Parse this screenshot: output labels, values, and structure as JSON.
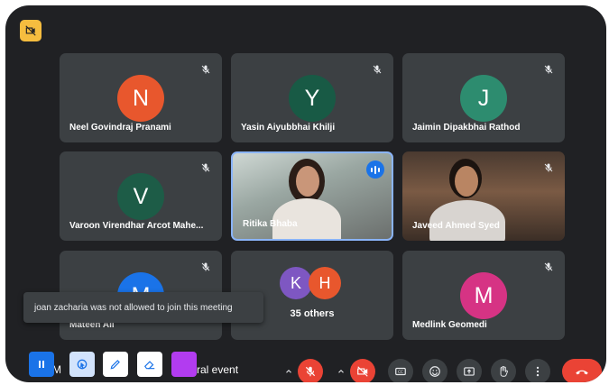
{
  "participants": [
    {
      "name": "Neel Govindraj Pranami",
      "initial": "N",
      "color": "#e8572d"
    },
    {
      "name": "Yasin Aiyubbhai Khilji",
      "initial": "Y",
      "color": "#185a45"
    },
    {
      "name": "Jaimin Dipakbhai Rathod",
      "initial": "J",
      "color": "#2d8c6f"
    },
    {
      "name": "Varoon Virendhar Arcot Mahe...",
      "initial": "V",
      "color": "#1d5c47"
    },
    {
      "name": "Ritika Bhaba"
    },
    {
      "name": "Javeed Ahmed Syed"
    },
    {
      "name": "Mateen Ali",
      "initial": "M",
      "color": "#1a73e8"
    },
    {
      "name": "Medlink Geomedi",
      "initial": "M",
      "color": "#d63384"
    }
  ],
  "others_group": {
    "avatars": [
      {
        "initial": "K",
        "color": "#7e57c2"
      },
      {
        "initial": "H",
        "color": "#e8572d"
      }
    ],
    "label": "35 others"
  },
  "toast": {
    "text": "joan zacharia was not allowed to join this meeting"
  },
  "meeting_title_fragment_1": "M",
  "meeting_title_fragment_2": "ral event",
  "annotation_toolbar": {
    "pen_color": "#b23cf0"
  },
  "icons": {
    "recording": "recording-icon",
    "mic_off": "mic-off-icon",
    "camera_off": "camera-off-icon",
    "captions": "captions-icon",
    "emoji": "emoji-icon",
    "present": "present-icon",
    "raise_hand": "raise-hand-icon",
    "more": "more-options-icon",
    "leave": "leave-call-icon",
    "pause": "pause-icon",
    "cursor": "cursor-icon",
    "pen": "pen-icon",
    "eraser": "eraser-icon"
  },
  "colors": {
    "background": "#202124",
    "tile": "#3c4043",
    "danger": "#ea4335",
    "active_speaker": "#1a73e8"
  }
}
